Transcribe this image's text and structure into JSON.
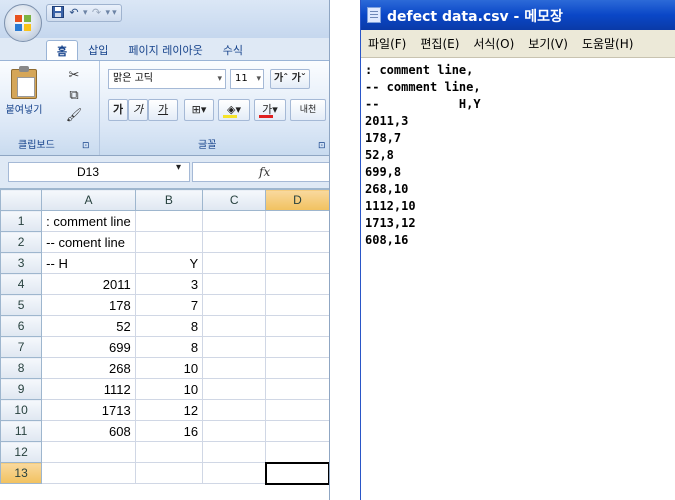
{
  "excel": {
    "quick_access": [
      "▾"
    ],
    "tabs": [
      "홈",
      "삽입",
      "페이지 레이아웃",
      "수식"
    ],
    "clipboard": {
      "paste_label": "붙여넣기",
      "group_label": "클립보드",
      "launcher": "⊡"
    },
    "font": {
      "name": "맑은 고딕",
      "size": "11",
      "grow": "가ˆ 가ˇ",
      "bold": "가",
      "italic": "가",
      "underline": "가",
      "phonetic": "내천",
      "group_label": "글꼴",
      "launcher": "⊡"
    },
    "name_box": "D13",
    "fx_label": "fx",
    "columns": [
      "A",
      "B",
      "C",
      "D"
    ],
    "rows": [
      {
        "num": "1",
        "a": ": comment line",
        "b": ""
      },
      {
        "num": "2",
        "a": "-- coment line",
        "b": ""
      },
      {
        "num": "3",
        "a": "--            H",
        "b": "Y"
      },
      {
        "num": "4",
        "a": "2011",
        "b": "3"
      },
      {
        "num": "5",
        "a": "178",
        "b": "7"
      },
      {
        "num": "6",
        "a": "52",
        "b": "8"
      },
      {
        "num": "7",
        "a": "699",
        "b": "8"
      },
      {
        "num": "8",
        "a": "268",
        "b": "10"
      },
      {
        "num": "9",
        "a": "1112",
        "b": "10"
      },
      {
        "num": "10",
        "a": "1713",
        "b": "12"
      },
      {
        "num": "11",
        "a": "608",
        "b": "16"
      },
      {
        "num": "12",
        "a": "",
        "b": ""
      },
      {
        "num": "13",
        "a": "",
        "b": ""
      }
    ]
  },
  "notepad": {
    "title": "defect data.csv - 메모장",
    "menu": [
      "파일(F)",
      "편집(E)",
      "서식(O)",
      "보기(V)",
      "도움말(H)"
    ],
    "lines": [
      ": comment line,",
      "-- comment line,",
      "--           H,Y",
      "2011,3",
      "178,7",
      "52,8",
      "699,8",
      "268,10",
      "1112,10",
      "1713,12",
      "608,16"
    ]
  }
}
